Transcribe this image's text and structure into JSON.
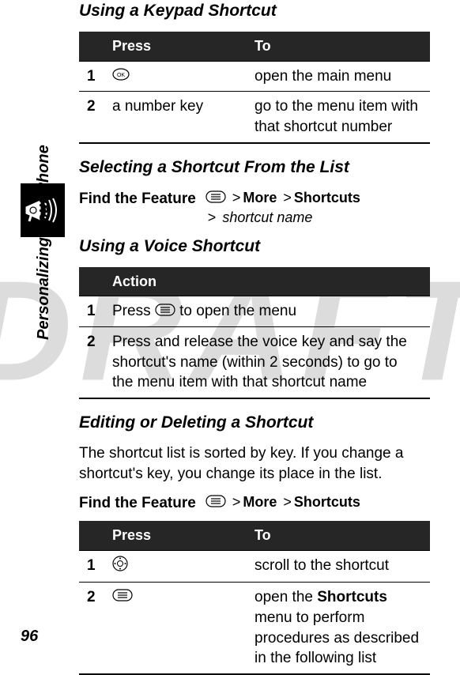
{
  "watermark": "DRAFT",
  "sideLabel": "Personalizing Your Phone",
  "pageNumber": "96",
  "sections": {
    "keypad": {
      "title": "Using a Keypad Shortcut"
    },
    "selectList": {
      "title": "Selecting a Shortcut From the List"
    },
    "voice": {
      "title": "Using a Voice Shortcut"
    },
    "editDelete": {
      "title": "Editing or Deleting a Shortcut"
    }
  },
  "table1": {
    "head": {
      "press": "Press",
      "to": "To"
    },
    "rows": [
      {
        "num": "1",
        "press_icon": "ok",
        "to": "open the main menu"
      },
      {
        "num": "2",
        "press_text": "a number key",
        "to": "go to the menu item with that shortcut number"
      }
    ]
  },
  "feature1": {
    "label": "Find the Feature",
    "icon": "menu",
    "sep": ">",
    "p1": "More",
    "p2": "Shortcuts",
    "p3": "shortcut name"
  },
  "table2": {
    "head": {
      "action": "Action"
    },
    "rows": [
      {
        "num": "1",
        "pre": "Press ",
        "icon": "menu",
        "post": " to open the menu"
      },
      {
        "num": "2",
        "text": "Press and release the voice key and say the shortcut's name (within 2 seconds) to go to the menu item with that shortcut name"
      }
    ]
  },
  "editBody": "The shortcut list is sorted by key. If you change a shortcut's key, you change its place in the list.",
  "feature2": {
    "label": "Find the Feature",
    "icon": "menu",
    "sep": ">",
    "p1": "More",
    "p2": "Shortcuts"
  },
  "table3": {
    "head": {
      "press": "Press",
      "to": "To"
    },
    "rows": [
      {
        "num": "1",
        "press_icon": "nav",
        "to": "scroll to the shortcut"
      },
      {
        "num": "2",
        "press_icon": "menu",
        "to_pre": "open the ",
        "to_bold": "Shortcuts",
        "to_post": " menu to perform procedures as described in the following list"
      }
    ]
  }
}
